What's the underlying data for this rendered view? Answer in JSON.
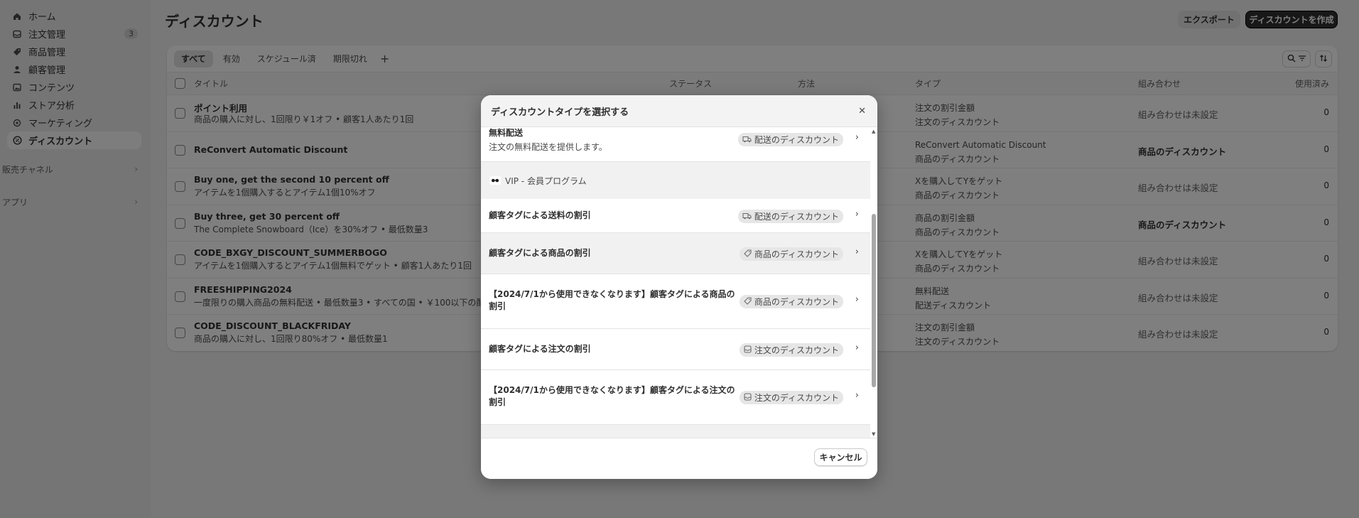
{
  "sidebar": {
    "items": [
      {
        "label": "ホーム",
        "icon": "home-icon"
      },
      {
        "label": "注文管理",
        "icon": "inbox-icon",
        "badge": "3"
      },
      {
        "label": "商品管理",
        "icon": "tag-icon"
      },
      {
        "label": "顧客管理",
        "icon": "person-icon"
      },
      {
        "label": "コンテンツ",
        "icon": "image-icon"
      },
      {
        "label": "ストア分析",
        "icon": "bar-chart-icon"
      },
      {
        "label": "マーケティング",
        "icon": "target-icon"
      },
      {
        "label": "ディスカウント",
        "icon": "discount-icon",
        "active": true
      }
    ],
    "sections": [
      "販売チャネル",
      "アプリ"
    ]
  },
  "header": {
    "title": "ディスカウント",
    "export_label": "エクスポート",
    "create_label": "ディスカウントを作成"
  },
  "tabs": [
    "すべて",
    "有効",
    "スケジュール済",
    "期限切れ"
  ],
  "table": {
    "columns": [
      "タイトル",
      "ステータス",
      "方法",
      "タイプ",
      "組み合わせ",
      "使用済み"
    ],
    "rows": [
      {
        "title": "ポイント利用",
        "subtitle": "商品の購入に対し、1回限り￥1オフ • 顧客1人あたり1回",
        "type1": "注文の割引金額",
        "type2": "注文のディスカウント",
        "combo": "組み合わせは未設定",
        "used": "0"
      },
      {
        "title": "ReConvert Automatic Discount",
        "subtitle": "",
        "type1": "ReConvert Automatic Discount",
        "type2": "商品のディスカウント",
        "combo": "商品のディスカウント",
        "used": "0"
      },
      {
        "title": "Buy one, get the second 10 percent off",
        "subtitle": "アイテムを1個購入するとアイテム1個10%オフ",
        "type1": "Xを購入してYをゲット",
        "type2": "商品のディスカウント",
        "combo": "組み合わせは未設定",
        "used": "0"
      },
      {
        "title": "Buy three, get 30 percent off",
        "subtitle": "The Complete Snowboard（Ice）を30%オフ • 最低数量3",
        "type1": "商品の割引金額",
        "type2": "商品のディスカウント",
        "combo": "商品のディスカウント",
        "used": "0"
      },
      {
        "title": "CODE_BXGY_DISCOUNT_SUMMERBOGO",
        "subtitle": "アイテムを1個購入するとアイテム1個無料でゲット • 顧客1人あたり1回",
        "type1": "Xを購入してYをゲット",
        "type2": "商品のディスカウント",
        "combo": "組み合わせは未設定",
        "used": "0"
      },
      {
        "title": "FREESHIPPING2024",
        "subtitle": "一度限りの購入商品の無料配送 • 最低数量3 • すべての国 • ￥100以下の配送",
        "type1": "無料配送",
        "type2": "配送ディスカウント",
        "combo": "組み合わせは未設定",
        "used": "0"
      },
      {
        "title": "CODE_DISCOUNT_BLACKFRIDAY",
        "subtitle": "商品の購入に対し、1回限り80%オフ • 最低数量1",
        "type1": "注文の割引金額",
        "type2": "注文のディスカウント",
        "combo": "組み合わせは未設定",
        "used": "0"
      }
    ]
  },
  "modal": {
    "title": "ディスカウントタイプを選択する",
    "group_label": "VIP - 会員プログラム",
    "options": [
      {
        "title": "無料配送",
        "subtitle": "注文の無料配送を提供します。",
        "pill": "配送のディスカウント",
        "pill_icon": "truck-icon"
      },
      {
        "title": "顧客タグによる送料の割引",
        "pill": "配送のディスカウント",
        "pill_icon": "truck-icon"
      },
      {
        "title": "顧客タグによる商品の割引",
        "pill": "商品のディスカウント",
        "pill_icon": "tag-icon"
      },
      {
        "title": "【2024/7/1から使用できなくなります】顧客タグによる商品の割引",
        "pill": "商品のディスカウント",
        "pill_icon": "tag-icon"
      },
      {
        "title": "顧客タグによる注文の割引",
        "pill": "注文のディスカウント",
        "pill_icon": "inbox-icon"
      },
      {
        "title": "【2024/7/1から使用できなくなります】顧客タグによる注文の割引",
        "pill": "注文のディスカウント",
        "pill_icon": "inbox-icon"
      }
    ],
    "cancel_label": "キャンセル"
  }
}
